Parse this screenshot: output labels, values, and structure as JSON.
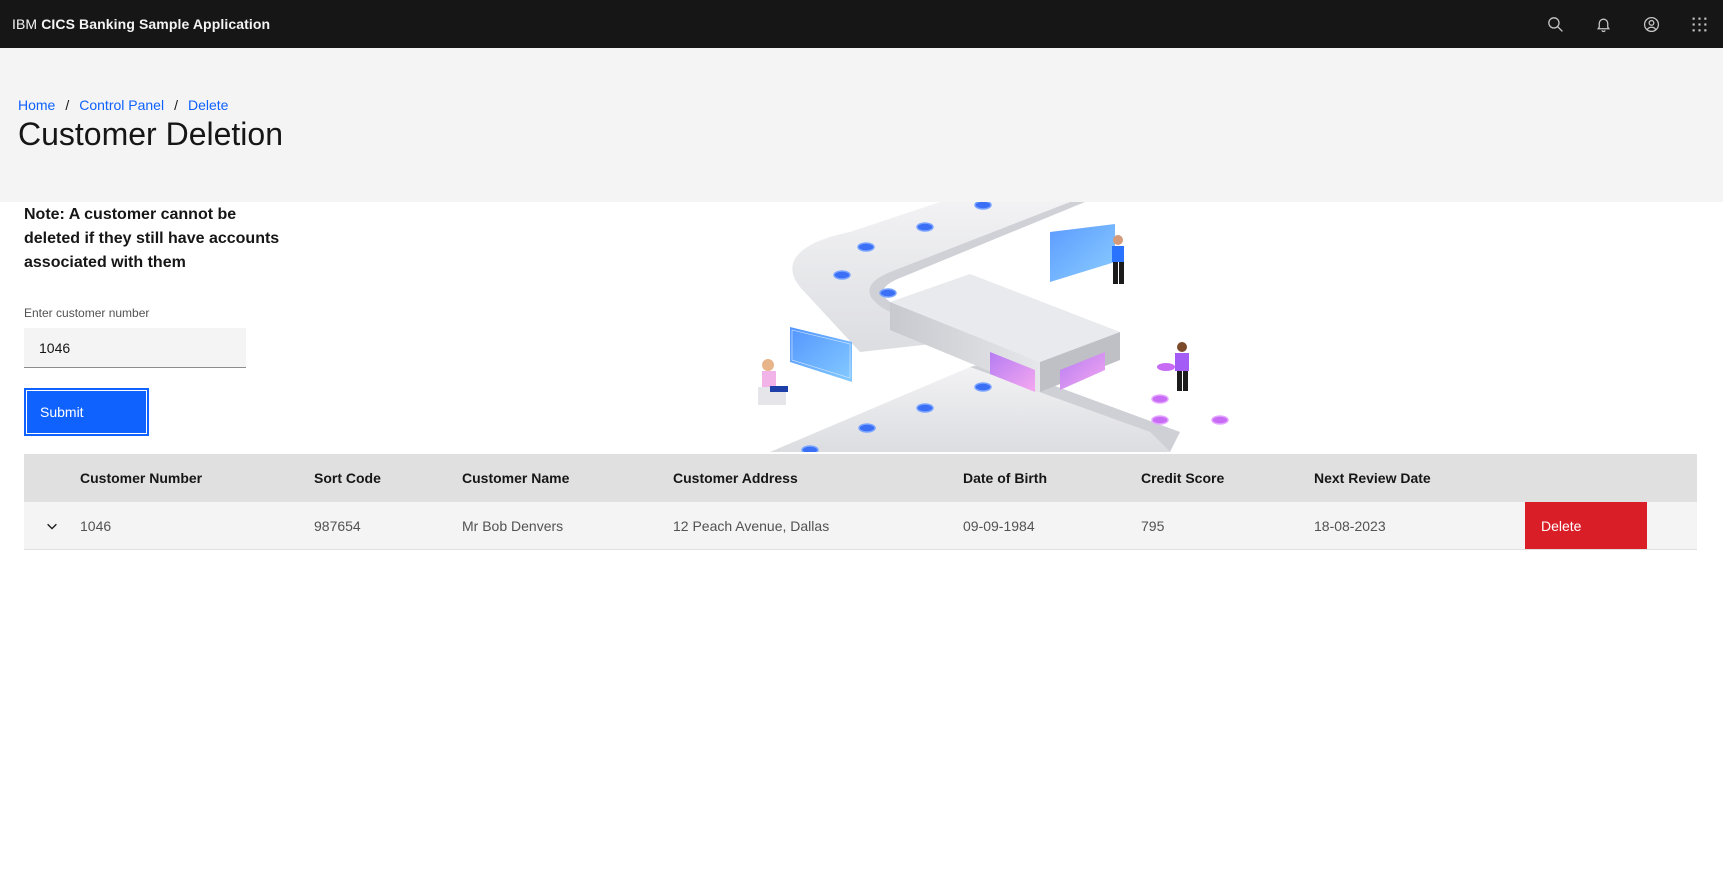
{
  "header": {
    "brand_prefix": "IBM",
    "brand_name": "CICS Banking Sample Application",
    "actions": [
      {
        "icon": "search-icon"
      },
      {
        "icon": "notification-icon"
      },
      {
        "icon": "user-avatar-icon"
      },
      {
        "icon": "app-switcher-icon"
      }
    ]
  },
  "breadcrumb": {
    "items": [
      "Home",
      "Control Panel",
      "Delete"
    ],
    "separator": "/"
  },
  "page": {
    "title": "Customer Deletion"
  },
  "form": {
    "note": "Note: A customer cannot be deleted if they still have accounts associated with them",
    "customer_number_label": "Enter customer number",
    "customer_number_value": "1046",
    "submit_label": "Submit"
  },
  "table": {
    "headers": [
      "Customer Number",
      "Sort Code",
      "Customer Name",
      "Customer Address",
      "Date of Birth",
      "Credit Score",
      "Next Review Date"
    ],
    "rows": [
      {
        "customer_number": "1046",
        "sort_code": "987654",
        "customer_name": "Mr Bob Denvers",
        "customer_address": "12 Peach Avenue, Dallas",
        "date_of_birth": "09-09-1984",
        "credit_score": "795",
        "next_review_date": "18-08-2023",
        "delete_label": "Delete"
      }
    ]
  },
  "colors": {
    "header_bg": "#161616",
    "link": "#0f62fe",
    "primary_button": "#0f62fe",
    "danger_button": "#da1e28",
    "band_bg": "#f4f4f4",
    "table_header_bg": "#e0e0e0"
  }
}
